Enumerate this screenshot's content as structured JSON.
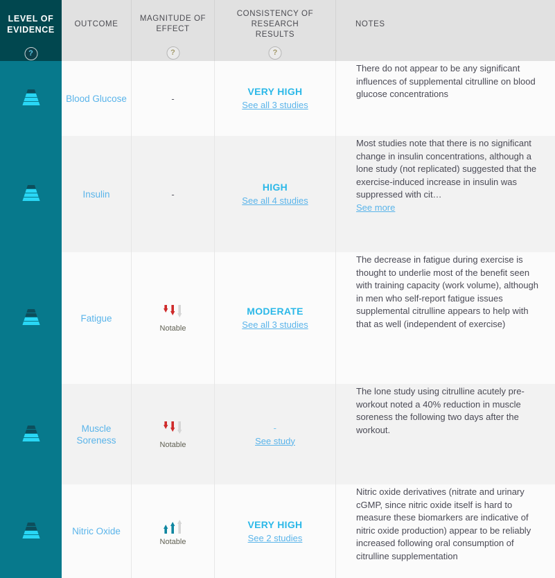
{
  "header": {
    "columns": [
      {
        "label": "LEVEL OF\nEVIDENCE",
        "has_help": true
      },
      {
        "label": "OUTCOME",
        "has_help": false
      },
      {
        "label": "MAGNITUDE OF\nEFFECT",
        "has_help": true
      },
      {
        "label": "CONSISTENCY OF RESEARCH\nRESULTS",
        "has_help": true
      },
      {
        "label": "NOTES",
        "has_help": false
      }
    ],
    "level_of_evidence": "LEVEL OF EVIDENCE",
    "outcome": "OUTCOME",
    "magnitude_of_effect": "MAGNITUDE OF EFFECT",
    "consistency": "CONSISTENCY OF RESEARCH RESULTS",
    "notes": "NOTES",
    "help_glyph": "?"
  },
  "colors": {
    "header_dark": "#01474f",
    "loe_column": "#07798c",
    "header_gray": "#e1e1e1",
    "link_blue": "#5ab4ea",
    "rating_blue": "#2bb8e8",
    "pyramid_bright": "#29d7f5",
    "pyramid_dark": "#0d4e5c",
    "arrow_down_red": "#cf2b2b",
    "arrow_up_teal": "#0f86a0",
    "arrow_gray": "#d6d6d6"
  },
  "rows": [
    {
      "evidence_icon": "pyramid-2-of-4",
      "evidence_filled": 2,
      "outcome": "Blood Glucose",
      "magnitude_value": "-",
      "magnitude_icon": "none",
      "magnitude_label": "",
      "consistency_rating": "VERY HIGH",
      "consistency_link": "See all 3 studies",
      "notes": "There do not appear to be any significant influences of supplemental citrulline on blood glucose concentrations",
      "notes_see_more": ""
    },
    {
      "evidence_icon": "pyramid-2-of-4",
      "evidence_filled": 2,
      "outcome": "Insulin",
      "magnitude_value": "-",
      "magnitude_icon": "none",
      "magnitude_label": "",
      "consistency_rating": "HIGH",
      "consistency_link": "See all 4 studies",
      "notes": "Most studies note that there is no significant change in insulin concentrations, although a lone study (not replicated) suggested that the exercise-induced increase in insulin was suppressed with cit…",
      "notes_see_more": "See more"
    },
    {
      "evidence_icon": "pyramid-1-of-4",
      "evidence_filled": 2,
      "outcome": "Fatigue",
      "magnitude_value": "",
      "magnitude_icon": "arrows-down-2-of-3",
      "magnitude_label": "Notable",
      "consistency_rating": "MODERATE",
      "consistency_link": "See all 3 studies",
      "notes": "The decrease in fatigue during exercise is thought to underlie most of the benefit seen with training capacity (work volume), although in men who self-report fatigue issues supplemental citrulline appears to help with that as well (independent of exercise)",
      "notes_see_more": ""
    },
    {
      "evidence_icon": "pyramid-1-of-4",
      "evidence_filled": 2,
      "outcome": "Muscle Soreness",
      "magnitude_value": "",
      "magnitude_icon": "arrows-down-2-of-3",
      "magnitude_label": "Notable",
      "consistency_rating": "-",
      "consistency_link": "See study",
      "notes": "The lone study using citrulline acutely pre-workout noted a 40% reduction in muscle soreness the following two days after the workout.",
      "notes_see_more": ""
    },
    {
      "evidence_icon": "pyramid-1-of-4",
      "evidence_filled": 2,
      "outcome": "Nitric Oxide",
      "magnitude_value": "",
      "magnitude_icon": "arrows-up-2-of-3",
      "magnitude_label": "Notable",
      "consistency_rating": "VERY HIGH",
      "consistency_link": "See 2 studies",
      "notes": "Nitric oxide derivatives (nitrate and urinary cGMP, since nitric oxide itself is hard to measure these biomarkers are indicative of nitric oxide production) appear to be reliably increased following oral consumption of citrulline supplementation",
      "notes_see_more": ""
    }
  ]
}
